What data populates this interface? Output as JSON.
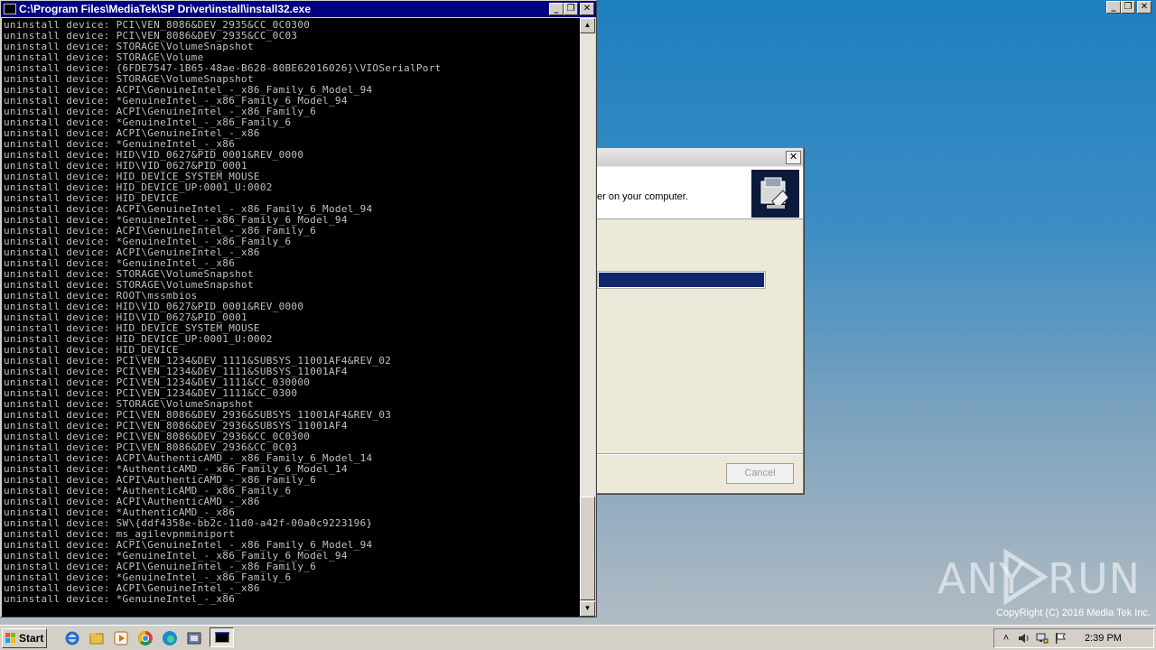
{
  "console_window": {
    "title": "C:\\Program Files\\MediaTek\\SP Driver\\install\\install32.exe",
    "lines": [
      "uninstall device: PCI\\VEN_8086&DEV_2935&CC_0C0300",
      "uninstall device: PCI\\VEN_8086&DEV_2935&CC_0C03",
      "uninstall device: STORAGE\\VolumeSnapshot",
      "uninstall device: STORAGE\\Volume",
      "uninstall device: {6FDE7547-1B65-48ae-B628-80BE62016026}\\VIOSerialPort",
      "uninstall device: STORAGE\\VolumeSnapshot",
      "uninstall device: ACPI\\GenuineIntel_-_x86_Family_6_Model_94",
      "uninstall device: *GenuineIntel_-_x86_Family_6_Model_94",
      "uninstall device: ACPI\\GenuineIntel_-_x86_Family_6",
      "uninstall device: *GenuineIntel_-_x86_Family_6",
      "uninstall device: ACPI\\GenuineIntel_-_x86",
      "uninstall device: *GenuineIntel_-_x86",
      "uninstall device: HID\\VID_0627&PID_0001&REV_0000",
      "uninstall device: HID\\VID_0627&PID_0001",
      "uninstall device: HID_DEVICE_SYSTEM_MOUSE",
      "uninstall device: HID_DEVICE_UP:0001_U:0002",
      "uninstall device: HID_DEVICE",
      "uninstall device: ACPI\\GenuineIntel_-_x86_Family_6_Model_94",
      "uninstall device: *GenuineIntel_-_x86_Family_6_Model_94",
      "uninstall device: ACPI\\GenuineIntel_-_x86_Family_6",
      "uninstall device: *GenuineIntel_-_x86_Family_6",
      "uninstall device: ACPI\\GenuineIntel_-_x86",
      "uninstall device: *GenuineIntel_-_x86",
      "uninstall device: STORAGE\\VolumeSnapshot",
      "uninstall device: STORAGE\\VolumeSnapshot",
      "uninstall device: ROOT\\mssmbios",
      "uninstall device: HID\\VID_0627&PID_0001&REV_0000",
      "uninstall device: HID\\VID_0627&PID_0001",
      "uninstall device: HID_DEVICE_SYSTEM_MOUSE",
      "uninstall device: HID_DEVICE_UP:0001_U:0002",
      "uninstall device: HID_DEVICE",
      "uninstall device: PCI\\VEN_1234&DEV_1111&SUBSYS_11001AF4&REV_02",
      "uninstall device: PCI\\VEN_1234&DEV_1111&SUBSYS_11001AF4",
      "uninstall device: PCI\\VEN_1234&DEV_1111&CC_030000",
      "uninstall device: PCI\\VEN_1234&DEV_1111&CC_0300",
      "uninstall device: STORAGE\\VolumeSnapshot",
      "uninstall device: PCI\\VEN_8086&DEV_2936&SUBSYS_11001AF4&REV_03",
      "uninstall device: PCI\\VEN_8086&DEV_2936&SUBSYS_11001AF4",
      "uninstall device: PCI\\VEN_8086&DEV_2936&CC_0C0300",
      "uninstall device: PCI\\VEN_8086&DEV_2936&CC_0C03",
      "uninstall device: ACPI\\AuthenticAMD_-_x86_Family_6_Model_14",
      "uninstall device: *AuthenticAMD_-_x86_Family_6_Model_14",
      "uninstall device: ACPI\\AuthenticAMD_-_x86_Family_6",
      "uninstall device: *AuthenticAMD_-_x86_Family_6",
      "uninstall device: ACPI\\AuthenticAMD_-_x86",
      "uninstall device: *AuthenticAMD_-_x86",
      "uninstall device: SW\\{ddf4358e-bb2c-11d0-a42f-00a0c9223196}",
      "uninstall device: ms_agilevpnminiport",
      "uninstall device: ACPI\\GenuineIntel_-_x86_Family_6_Model_94",
      "uninstall device: *GenuineIntel_-_x86_Family_6_Model_94",
      "uninstall device: ACPI\\GenuineIntel_-_x86_Family_6",
      "uninstall device: *GenuineIntel_-_x86_Family_6",
      "uninstall device: ACPI\\GenuineIntel_-_x86",
      "uninstall device: *GenuineIntel_-_x86"
    ]
  },
  "installer_dialog": {
    "header_message": "er on your computer.",
    "cancel_label": "Cancel",
    "progress_fraction": 1.0
  },
  "window_controls": {
    "minimize": "_",
    "restore": "❐",
    "close": "✕"
  },
  "watermark": {
    "left": "ANY",
    "right": "RUN"
  },
  "copyright": "CopyRight (C) 2016 Media Tek Inc.",
  "taskbar": {
    "start_label": "Start",
    "clock": "2:39 PM",
    "quick_launch": [
      "ie-icon",
      "folder-icon",
      "media-player-icon",
      "chrome-icon",
      "edge-icon",
      "installer-icon"
    ],
    "tray_icons": [
      "show-hidden-icon",
      "volume-icon",
      "network-icon",
      "action-center-flag-icon"
    ]
  },
  "colors": {
    "console_bg": "#000000",
    "console_text": "#c0c0c0",
    "titlebar": "#000080",
    "progress_fill": "#10256b"
  }
}
